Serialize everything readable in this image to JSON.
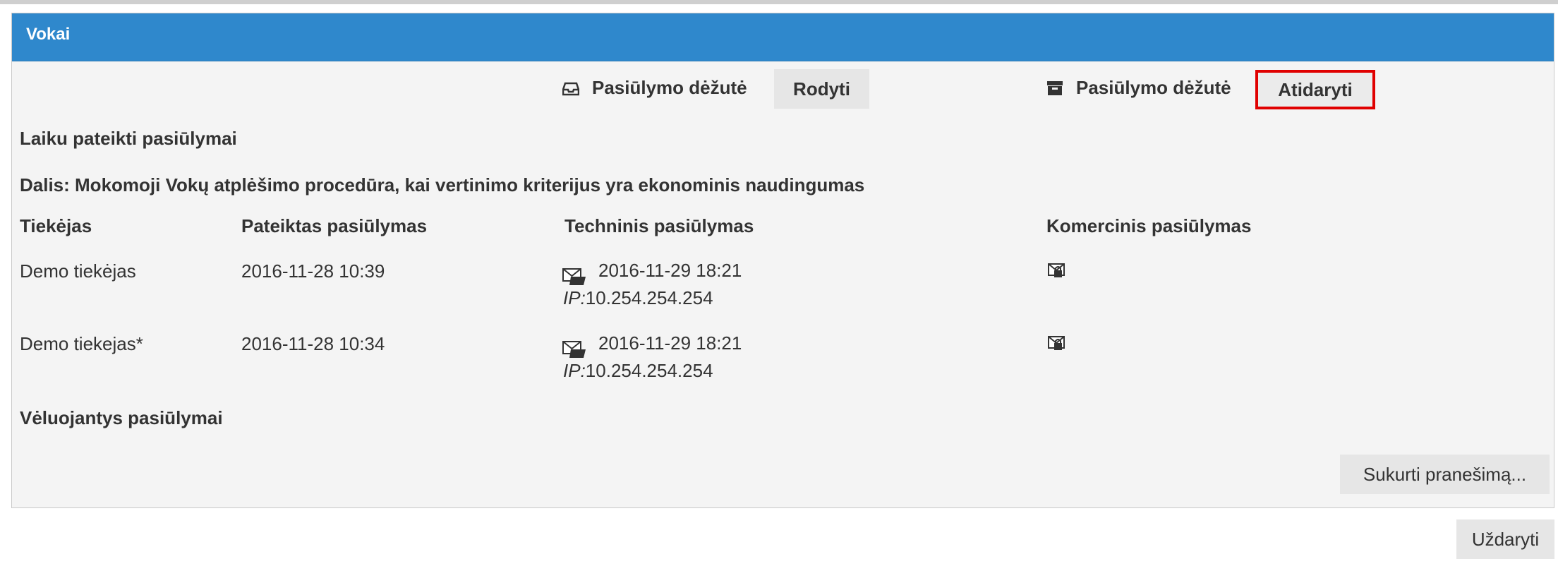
{
  "panel": {
    "title": "Vokai"
  },
  "envelope_boxes": [
    {
      "icon": "inbox-icon",
      "label": "Pasiūlymo dėžutė",
      "button_label": "Rodyti"
    },
    {
      "icon": "archive-box-icon",
      "label": "Pasiūlymo dėžutė",
      "button_label": "Atidaryti"
    }
  ],
  "sections": {
    "on_time_heading": "Laiku pateikti pasiūlymai",
    "lot_heading": "Dalis: Mokomoji Vokų atplėšimo procedūra, kai vertinimo kriterijus yra ekonominis naudingumas",
    "late_heading": "Vėluojantys pasiūlymai"
  },
  "table": {
    "columns": [
      "Tiekėjas",
      "Pateiktas pasiūlymas",
      "Techninis pasiūlymas",
      "Komercinis pasiūlymas"
    ],
    "rows": [
      {
        "supplier": "Demo tiekėjas",
        "submitted": "2016-11-28 10:39",
        "technical_icon": "opened-envelope-icon",
        "technical_opened": "2016-11-29 18:21",
        "ip_label": "IP:",
        "ip_value": "10.254.254.254",
        "commercial_icon": "sealed-envelope-icon"
      },
      {
        "supplier": "Demo tiekejas*",
        "submitted": "2016-11-28 10:34",
        "technical_icon": "opened-envelope-icon",
        "technical_opened": "2016-11-29 18:21",
        "ip_label": "IP:",
        "ip_value": "10.254.254.254",
        "commercial_icon": "sealed-envelope-icon"
      }
    ]
  },
  "buttons": {
    "create_message": "Sukurti pranešimą...",
    "close": "Uždaryti"
  }
}
